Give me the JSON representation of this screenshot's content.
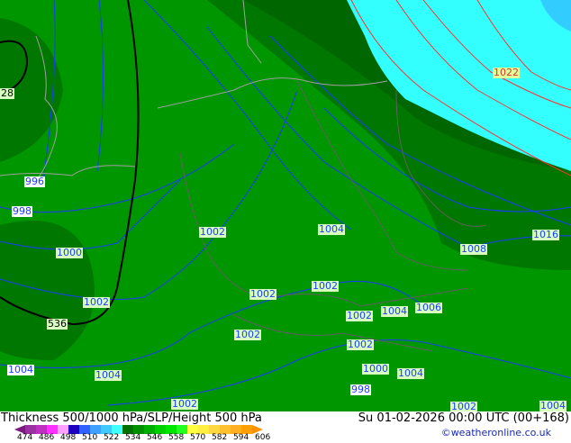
{
  "map": {
    "colors": {
      "base": "#009600",
      "dark": "#007800",
      "darker": "#006600",
      "cyan": "#33ffff",
      "blue": "#33ccff",
      "isobar": "#1a3cff",
      "isobar_high": "#ff3030",
      "thickness": "#000000",
      "border": "#a0a0a0"
    },
    "labels": [
      {
        "text": "28",
        "style": "k"
      },
      {
        "text": "996",
        "style": "w"
      },
      {
        "text": "998",
        "style": "w"
      },
      {
        "text": "1000",
        "style": ""
      },
      {
        "text": "1002",
        "style": ""
      },
      {
        "text": "536",
        "style": "k"
      },
      {
        "text": "1004",
        "style": "w"
      },
      {
        "text": "1004",
        "style": ""
      },
      {
        "text": "1002",
        "style": ""
      },
      {
        "text": "1002",
        "style": ""
      },
      {
        "text": "1004",
        "style": ""
      },
      {
        "text": "1002",
        "style": ""
      },
      {
        "text": "1002",
        "style": ""
      },
      {
        "text": "1002",
        "style": ""
      },
      {
        "text": "1004",
        "style": ""
      },
      {
        "text": "1006",
        "style": ""
      },
      {
        "text": "1002",
        "style": ""
      },
      {
        "text": "1002",
        "style": ""
      },
      {
        "text": "1000",
        "style": ""
      },
      {
        "text": "1004",
        "style": ""
      },
      {
        "text": "998",
        "style": "w"
      },
      {
        "text": "1008",
        "style": ""
      },
      {
        "text": "1016",
        "style": ""
      },
      {
        "text": "1022",
        "style": "r"
      },
      {
        "text": "1002",
        "style": ""
      },
      {
        "text": "1004",
        "style": ""
      }
    ]
  },
  "footer": {
    "title": "Thickness 500/1000 hPa/SLP/Height 500 hPa",
    "datetime": "Su 01-02-2026 00:00 UTC (00+168)",
    "credit": "©weatheronline.co.uk",
    "colorbar": {
      "colors": [
        "#7a1a80",
        "#9b30a0",
        "#c030c0",
        "#ff30ff",
        "#ffa0ff",
        "#2000c0",
        "#3060ff",
        "#40a0ff",
        "#40c8ff",
        "#40ffff",
        "#007000",
        "#009000",
        "#00b000",
        "#00d000",
        "#00e800",
        "#20ff20",
        "#ffff40",
        "#ffef40",
        "#ffd840",
        "#ffc030",
        "#ffb020",
        "#ffa000",
        "#ff9000"
      ],
      "ticks": [
        "474",
        "486",
        "498",
        "510",
        "522",
        "534",
        "546",
        "558",
        "570",
        "582",
        "594",
        "606"
      ]
    }
  }
}
